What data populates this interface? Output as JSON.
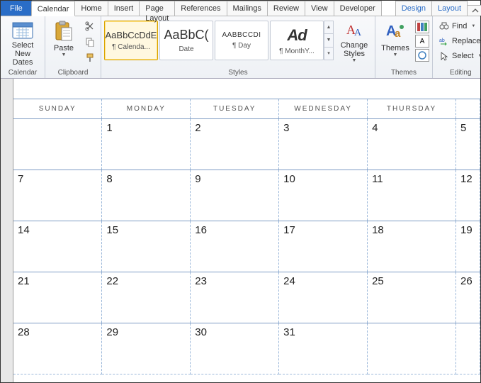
{
  "tabs": {
    "file": "File",
    "list": [
      "Calendar",
      "Home",
      "Insert",
      "Page Layout",
      "References",
      "Mailings",
      "Review",
      "View",
      "Developer"
    ],
    "contextual": [
      "Design",
      "Layout"
    ],
    "active": "Calendar"
  },
  "ribbon": {
    "calendar": {
      "select_new_dates": "Select New Dates",
      "group": "Calendar"
    },
    "clipboard": {
      "paste": "Paste",
      "group": "Clipboard"
    },
    "styles": {
      "group": "Styles",
      "items": [
        {
          "sample": "AaBbCcDdE",
          "sub": "¶ Calenda...",
          "selected": true
        },
        {
          "sample": "AaBbC(",
          "sub": "Date"
        },
        {
          "sample": "AABBCCDI",
          "sub": "¶ Day",
          "caps": true
        },
        {
          "sample": "Ad",
          "sub": "¶ MonthY...",
          "big": true
        }
      ],
      "change_styles": "Change Styles"
    },
    "themes": {
      "themes": "Themes",
      "group": "Themes",
      "swatch": "Aa"
    },
    "editing": {
      "find": "Find",
      "replace": "Replace",
      "select": "Select",
      "group": "Editing"
    }
  },
  "calendar_doc": {
    "headers": [
      "SUNDAY",
      "MONDAY",
      "TUESDAY",
      "WEDNESDAY",
      "THURSDAY",
      ""
    ],
    "rows": [
      [
        "",
        "1",
        "2",
        "3",
        "4",
        "5"
      ],
      [
        "7",
        "8",
        "9",
        "10",
        "11",
        "12"
      ],
      [
        "14",
        "15",
        "16",
        "17",
        "18",
        "19"
      ],
      [
        "21",
        "22",
        "23",
        "24",
        "25",
        "26"
      ],
      [
        "28",
        "29",
        "30",
        "31",
        "",
        ""
      ]
    ]
  }
}
